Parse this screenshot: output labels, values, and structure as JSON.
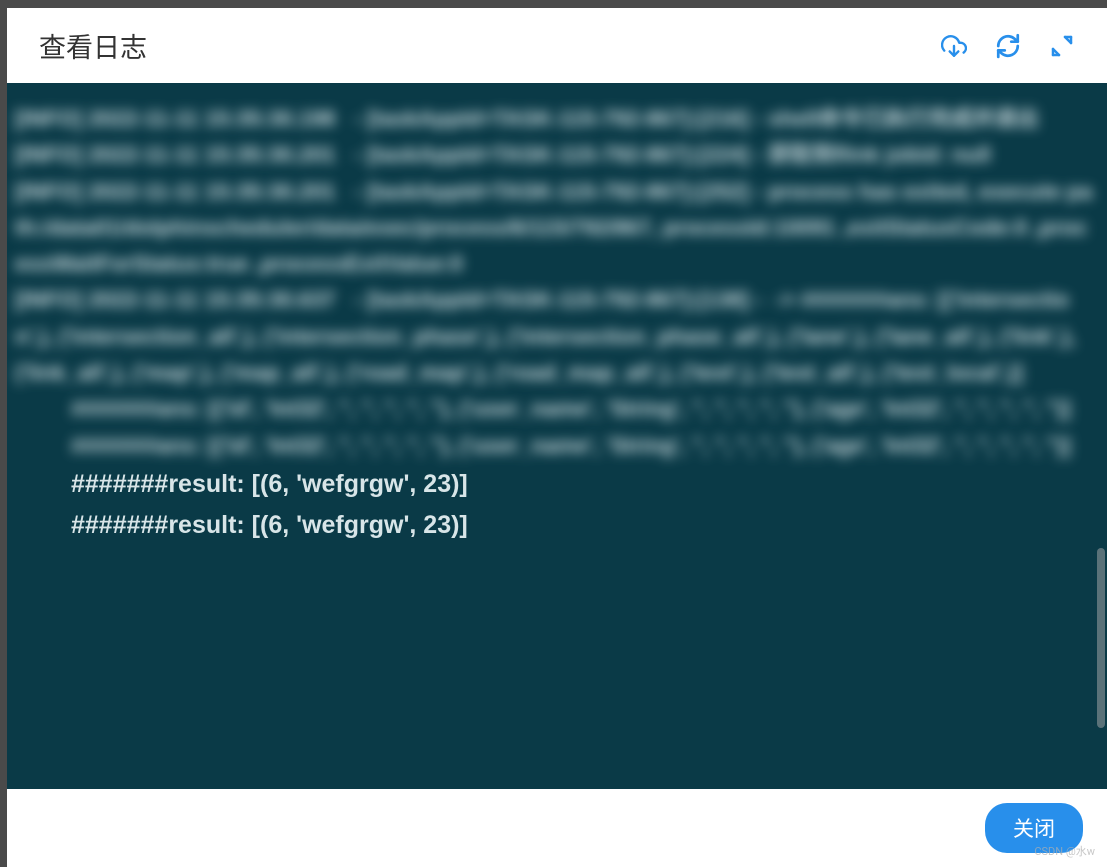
{
  "modal": {
    "title": "查看日志"
  },
  "toolbar": {
    "download_icon": "download",
    "refresh_icon": "refresh",
    "fullscreen_icon": "fullscreen"
  },
  "logs": {
    "lines": [
      {
        "text": "[INFO] 2022-11-11 15:35:30.198   - [taskAppId=TASK-115-792-867]:[216] - shell命令已执行完成并退出",
        "blurred": true,
        "indented": false
      },
      {
        "text": "[INFO] 2022-11-11 15:35:30.201   - [taskAppId=TASK-115-792-867]:[224] - 获取到flink jobid: null",
        "blurred": true,
        "indented": false
      },
      {
        "text": "[INFO] 2022-11-11 15:35:30.201   - [taskAppId=TASK-115-792-867]:[252] - process has exited, execute path:/data01/dolphinscheduler/data/exec/process/6/115/792/867, processId:10091 ,exitStatusCode:0 ,processWaitForStatus:true ,processExitValue:0",
        "blurred": true,
        "indented": false
      },
      {
        "text": "[INFO] 2022-11-11 15:35:30.637   - [taskAppId=TASK-115-792-867]:[138] -  -> #######ans: [('intersection',), ('intersection_all',), ('intersection_phase',), ('intersection_phase_all',), ('lane',), ('lane_all',), ('link',), ('link_all',), ('map',), ('map_all',), ('road_map',), ('road_map_all',), ('test',), ('test_all',), ('test_local',)]",
        "blurred": true,
        "indented": false
      },
      {
        "text": "#######ans: [('id', 'Int32', '', '', '', '', ''), ('user_name', 'String', '', '', '', '', ''), ('age', 'Int32', '', '', '', '', '')]",
        "blurred": true,
        "indented": true
      },
      {
        "text": "#######ans: [('id', 'Int32', '', '', '', '', ''), ('user_name', 'String', '', '', '', '', ''), ('age', 'Int32', '', '', '', '', '')]",
        "blurred": true,
        "indented": true
      },
      {
        "text": "#######result: [(6, 'wefgrgw', 23)]",
        "blurred": false,
        "indented": false,
        "result": true
      },
      {
        "text": "#######result: [(6, 'wefgrgw', 23)]",
        "blurred": false,
        "indented": false,
        "result": true
      }
    ]
  },
  "footer": {
    "close_label": "关闭"
  },
  "watermark": "CSDN @水w"
}
